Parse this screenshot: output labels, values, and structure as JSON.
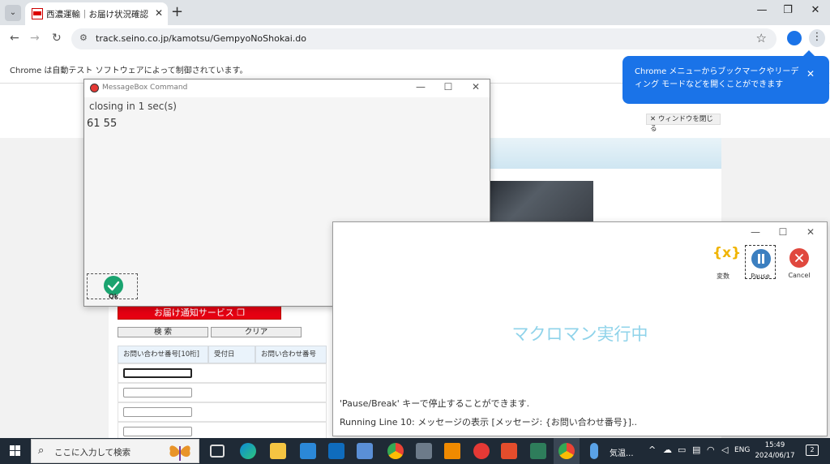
{
  "browser": {
    "tab_title": "西濃運輸｜お届け状況確認",
    "tab_close": "✕",
    "new_tab": "+",
    "url": "track.seino.co.jp/kamotsu/GempyoNoShokai.do",
    "infobar": "Chrome は自動テスト ソフトウェアによって制御されています。",
    "minimize": "—",
    "restore": "❐",
    "close": "✕"
  },
  "tip": {
    "text": "Chrome メニューからブックマークやリーディング モードなどを開くことができます",
    "close": "✕"
  },
  "page": {
    "close_window": "✕ ウィンドウを閉じる",
    "notify_button": "お届け通知サービス ❐",
    "search_button": "検 索",
    "clear_button": "クリア",
    "col_inquiry_10": "お問い合わせ番号[10桁]",
    "col_received": "受付日",
    "col_inquiry": "お問い合わせ番号"
  },
  "msgbox": {
    "title": "MessageBox Command",
    "countdown": "closing in 1 sec(s)",
    "message": "61 55",
    "ok_label": "Ok"
  },
  "macro": {
    "var_label": "変数",
    "var_icon": "{x}",
    "pause_label": "Pause",
    "cancel_label": "Cancel",
    "running": "マクロマン実行中",
    "hint": "'Pause/Break' キーで停止することができます.",
    "line": "Running Line 10: メッセージの表示 [メッセージ: {お問い合わせ番号}].."
  },
  "taskbar": {
    "search_placeholder": "ここに入力して検索",
    "weather": "気温...",
    "lang": "ENG",
    "time": "15:49",
    "date": "2024/06/17",
    "notifications": "2"
  },
  "colors": {
    "chrome_blue": "#1a73e8",
    "seino_red": "#e60012",
    "ok_green": "#1aa36f",
    "pause_blue": "#3c7fc0",
    "cancel_red": "#e0483e",
    "running_text": "#8fd3ea"
  }
}
